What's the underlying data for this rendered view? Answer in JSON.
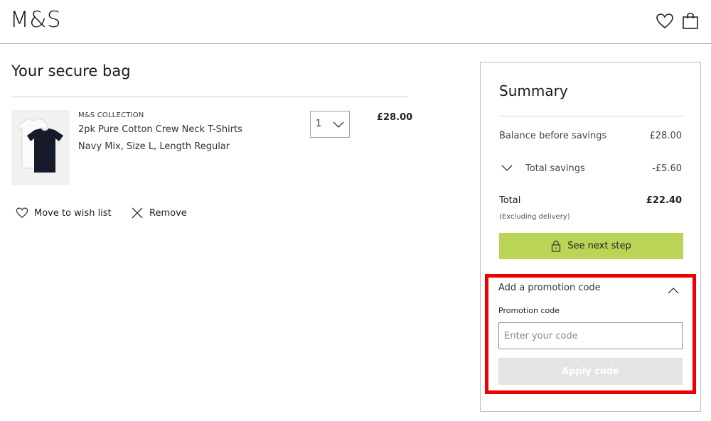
{
  "header": {
    "logo": "M&S",
    "icons": [
      "heart-icon",
      "shopping-bag-icon"
    ]
  },
  "bag": {
    "title": "Your secure bag",
    "item": {
      "brand": "M&S COLLECTION",
      "name": "2pk Pure Cotton Crew Neck T-Shirts",
      "variant": "Navy Mix, Size L, Length Regular",
      "quantity": "1",
      "price": "£28.00"
    },
    "actions": {
      "wishlist": "Move to wish list",
      "remove": "Remove"
    }
  },
  "summary": {
    "title": "Summary",
    "balance_label": "Balance before savings",
    "balance_value": "£28.00",
    "savings_label": "Total savings",
    "savings_value": "-£5.60",
    "total_label": "Total",
    "total_value": "£22.40",
    "total_note": "(Excluding delivery)",
    "next_step": "See next step"
  },
  "promo": {
    "title": "Add a promotion code",
    "field_label": "Promotion code",
    "placeholder": "Enter your code",
    "apply_label": "Apply code"
  },
  "colors": {
    "accent_green": "#bad455",
    "highlight_red": "#ee0000",
    "disabled_button": "#e4e4e4"
  }
}
